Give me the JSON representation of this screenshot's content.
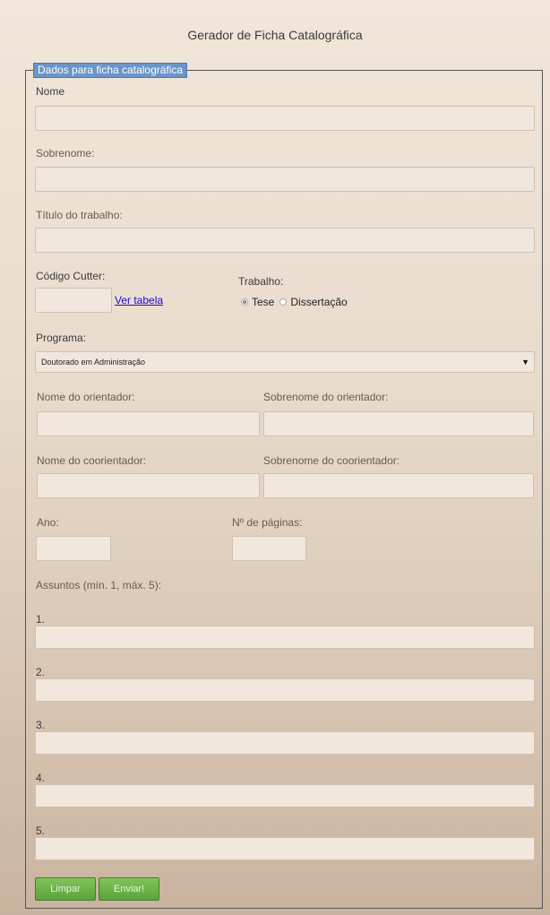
{
  "page": {
    "title": "Gerador de Ficha Catalográfica"
  },
  "form": {
    "legend": "Dados para ficha catalográfica",
    "nome_label": "Nome",
    "sobrenome_label": "Sobrenome:",
    "titulo_label": "Título do trabalho:",
    "cutter_label": "Código Cutter:",
    "cutter_link": "Ver tabela",
    "trabalho_label": "Trabalho:",
    "trabalho_options": [
      "Tese",
      "Dissertação"
    ],
    "trabalho_selected": "Tese",
    "programa_label": "Programa:",
    "programa_value": "Doutorado em Administração",
    "orientador_nome_label": "Nome do orientador:",
    "orientador_sobrenome_label": "Sobrenome do orientador:",
    "coorientador_nome_label": "Nome do coorientador:",
    "coorientador_sobrenome_label": "Sobrenome do coorientador:",
    "ano_label": "Ano:",
    "paginas_label": "Nº de páginas:",
    "assuntos_label": "Assuntos (mín. 1, máx. 5):",
    "assuntos_numbers": [
      "1.",
      "2.",
      "3.",
      "4.",
      "5."
    ],
    "limpar_label": "Limpar",
    "enviar_label": "Enviar!"
  },
  "icons": {
    "select_arrow": "chevron-down-icon"
  }
}
